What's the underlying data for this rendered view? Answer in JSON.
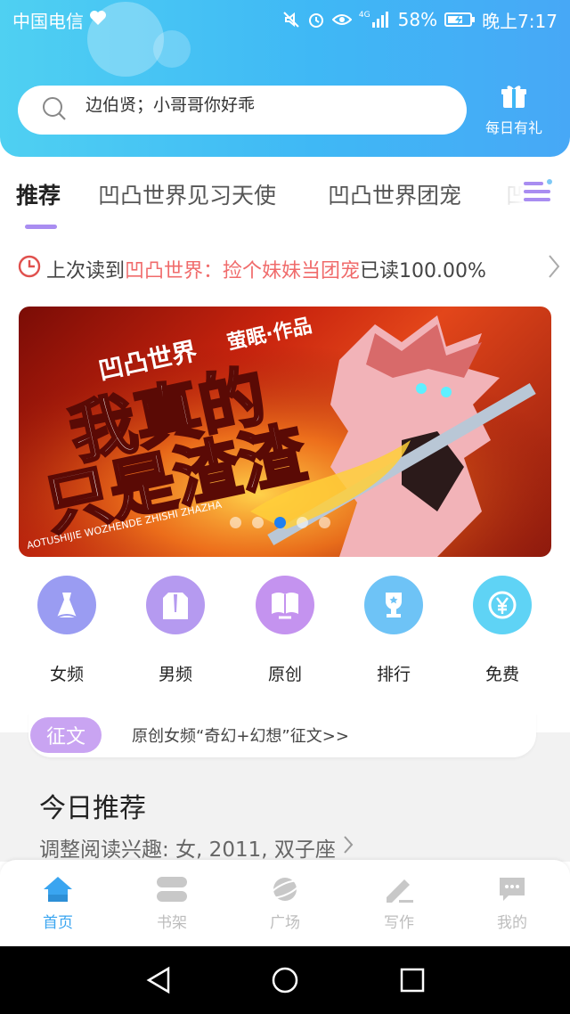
{
  "status_bar": {
    "carrier": "中国电信",
    "battery": "58%",
    "network": "4G",
    "time": "晚上7:17"
  },
  "search": {
    "placeholder": "边伯贤；小哥哥你好乖",
    "icon": "search-icon"
  },
  "gift": {
    "label": "每日有礼",
    "icon": "gift-icon"
  },
  "tabs": [
    {
      "label": "推荐",
      "active": true
    },
    {
      "label": "凹凸世界见习天使",
      "active": false
    },
    {
      "label": "凹凸世界团宠",
      "active": false
    },
    {
      "label": "凹",
      "active": false
    }
  ],
  "last_read": {
    "prefix": "上次读到",
    "book": "凹凸世界：捡个妹妹当团宠",
    "progress": "已读100.00%"
  },
  "banner": {
    "title_line1": "我真的",
    "title_line2": "只是渣渣",
    "series": "凹凸世界",
    "author": "萤眠·作品",
    "pinyin": "AOTUSHIJIE WOZHENDE ZHISHI ZHAZHA",
    "slide_count": 5,
    "active_slide": 2
  },
  "categories": [
    {
      "label": "女频",
      "icon": "dress-icon",
      "color": "#9a9cf2"
    },
    {
      "label": "男频",
      "icon": "shirt-icon",
      "color": "#b59af0"
    },
    {
      "label": "原创",
      "icon": "book-icon",
      "color": "#c493ef"
    },
    {
      "label": "排行",
      "icon": "trophy-icon",
      "color": "#6ec3f6"
    },
    {
      "label": "免费",
      "icon": "yen-icon",
      "color": "#5fd3f5"
    }
  ],
  "contest": {
    "badge": "征文",
    "text": "原创女频“奇幻+幻想”征文>>"
  },
  "today": {
    "title": "今日推荐",
    "subtitle": "调整阅读兴趣: 女, 2011, 双子座"
  },
  "bottom_nav": [
    {
      "label": "首页",
      "icon": "home-icon",
      "active": true
    },
    {
      "label": "书架",
      "icon": "bookshelf-icon",
      "active": false
    },
    {
      "label": "广场",
      "icon": "planet-icon",
      "active": false
    },
    {
      "label": "写作",
      "icon": "pen-icon",
      "active": false
    },
    {
      "label": "我的",
      "icon": "chat-icon",
      "active": false
    }
  ],
  "colors": {
    "accent": "#3aa5f0",
    "tab_indicator": "#a98df1",
    "highlight": "#f06b6b",
    "badge": "#c9a4f2"
  }
}
